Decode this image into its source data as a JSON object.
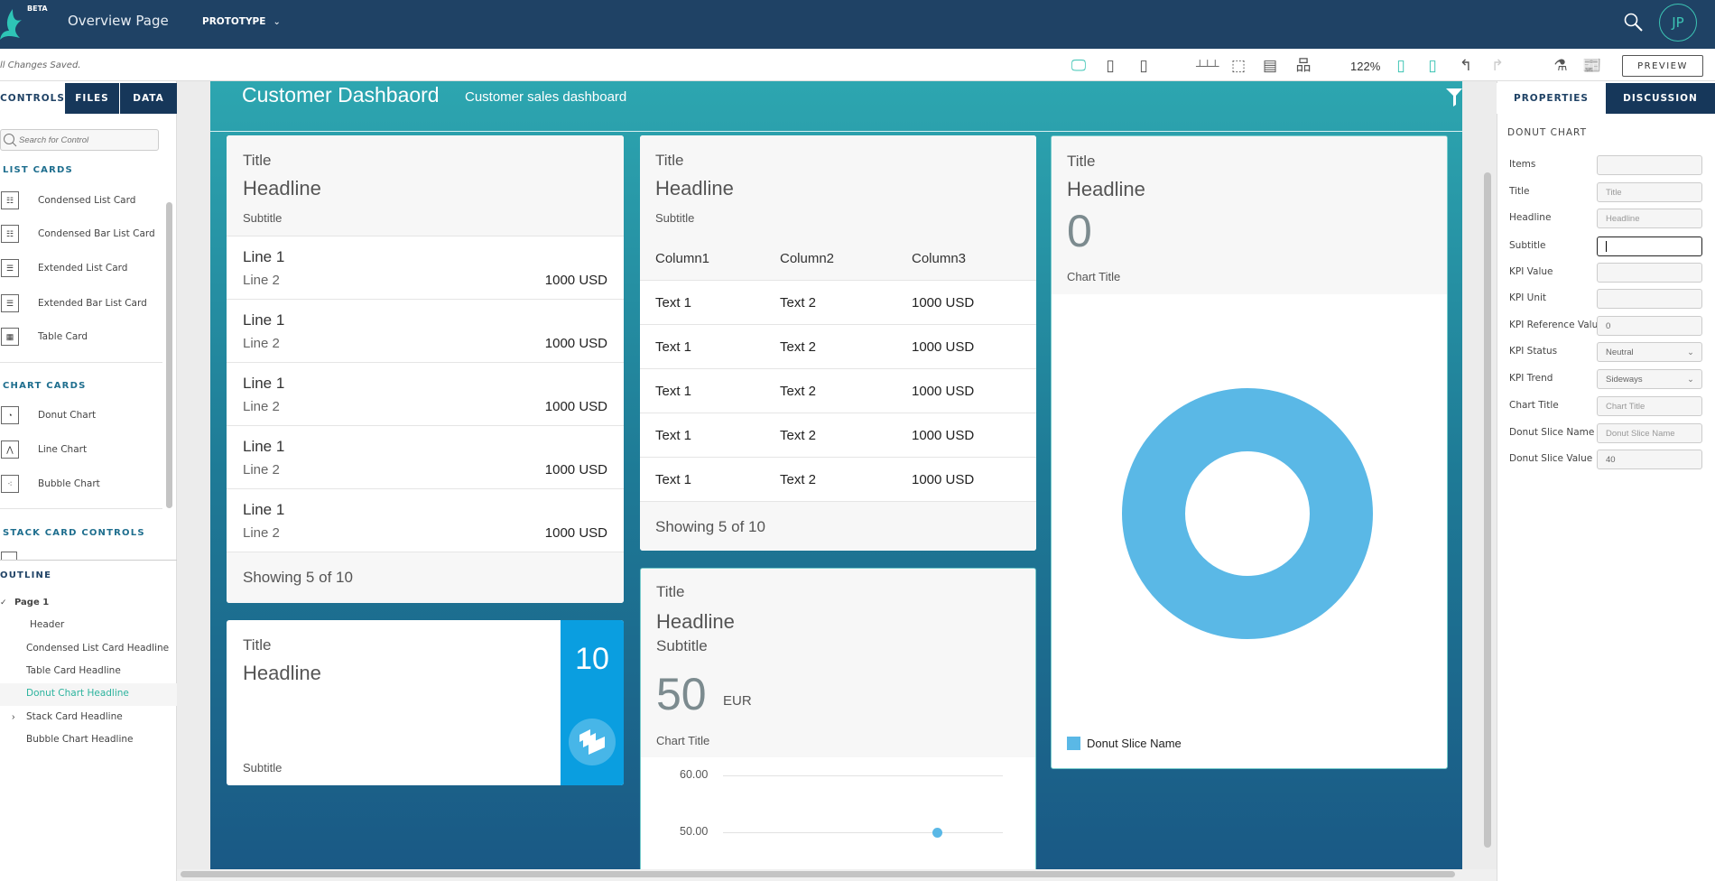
{
  "topbar": {
    "beta": "BETA",
    "app_title": "Overview Page",
    "mode": "PROTOTYPE",
    "mode_chevron": "chevron-down-icon",
    "avatar": "JP"
  },
  "toolbar": {
    "status": "ll Changes Saved.",
    "zoom": "122%",
    "preview": "PREVIEW",
    "accent": "#3cc4b4"
  },
  "left": {
    "tabs": [
      "CONTROLS",
      "FILES",
      "DATA"
    ],
    "search_placeholder": "Search for Control",
    "sections": [
      {
        "title": "LIST CARDS",
        "items": [
          "Condensed List Card",
          "Condensed Bar List Card",
          "Extended List Card",
          "Extended Bar List Card",
          "Table Card"
        ]
      },
      {
        "title": "CHART CARDS",
        "items": [
          "Donut Chart",
          "Line Chart",
          "Bubble Chart"
        ]
      },
      {
        "title": "STACK CARD CONTROLS",
        "items": []
      }
    ],
    "outline": {
      "title": "OUTLINE",
      "page": "Page 1",
      "items": [
        "Header",
        "Condensed List Card Headline",
        "Table Card Headline",
        "Donut Chart Headline",
        "Stack Card Headline",
        "Bubble Chart Headline"
      ],
      "selected": "Donut Chart Headline"
    }
  },
  "dashboard": {
    "title": "Customer Dashbaord",
    "subtitle": "Customer sales dashboard",
    "list_card": {
      "title": "Title",
      "headline": "Headline",
      "subtitle": "Subtitle",
      "rows": [
        {
          "l1": "Line 1",
          "l2": "Line 2",
          "value": "1000 USD"
        },
        {
          "l1": "Line 1",
          "l2": "Line 2",
          "value": "1000 USD"
        },
        {
          "l1": "Line 1",
          "l2": "Line 2",
          "value": "1000 USD"
        },
        {
          "l1": "Line 1",
          "l2": "Line 2",
          "value": "1000 USD"
        },
        {
          "l1": "Line 1",
          "l2": "Line 2",
          "value": "1000 USD"
        }
      ],
      "footer": "Showing 5 of 10"
    },
    "table_card": {
      "title": "Title",
      "headline": "Headline",
      "subtitle": "Subtitle",
      "columns": [
        "Column1",
        "Column2",
        "Column3"
      ],
      "rows": [
        [
          "Text 1",
          "Text 2",
          "1000 USD"
        ],
        [
          "Text 1",
          "Text 2",
          "1000 USD"
        ],
        [
          "Text 1",
          "Text 2",
          "1000 USD"
        ],
        [
          "Text 1",
          "Text 2",
          "1000 USD"
        ],
        [
          "Text 1",
          "Text 2",
          "1000 USD"
        ]
      ],
      "footer": "Showing 5 of 10"
    },
    "donut_card": {
      "title": "Title",
      "headline": "Headline",
      "kpi": "0",
      "chart_title": "Chart Title",
      "legend": "Donut Slice Name",
      "slice_value": 40,
      "color": "#5ab8e6"
    },
    "stack_card": {
      "title": "Title",
      "headline": "Headline",
      "subtitle": "Subtitle",
      "count": "10",
      "color": "#0a9ee0"
    },
    "line_card": {
      "title": "Title",
      "headline": "Headline",
      "subtitle": "Subtitle",
      "kpi": "50",
      "unit": "EUR",
      "chart_title": "Chart Title",
      "y_ticks": [
        "60.00",
        "50.00"
      ],
      "points": [
        50
      ]
    }
  },
  "right": {
    "tabs": [
      "PROPERTIES",
      "DISCUSSION"
    ],
    "section": "DONUT CHART",
    "fields": [
      {
        "label": "Items",
        "value": "",
        "placeholder": ""
      },
      {
        "label": "Title",
        "value": "",
        "placeholder": "Title"
      },
      {
        "label": "Headline",
        "value": "",
        "placeholder": "Headline"
      },
      {
        "label": "Subtitle",
        "value": "",
        "placeholder": "",
        "focused": true
      },
      {
        "label": "KPI Value",
        "value": "",
        "placeholder": ""
      },
      {
        "label": "KPI Unit",
        "value": "",
        "placeholder": ""
      },
      {
        "label": "KPI Reference Value",
        "value": "0",
        "placeholder": ""
      },
      {
        "label": "KPI Status",
        "value": "Neutral",
        "select": true
      },
      {
        "label": "KPI Trend",
        "value": "Sideways",
        "select": true
      },
      {
        "label": "Chart Title",
        "value": "",
        "placeholder": "Chart Title"
      },
      {
        "label": "Donut Slice Name",
        "value": "",
        "placeholder": "Donut Slice Name"
      },
      {
        "label": "Donut Slice Value",
        "value": "40",
        "placeholder": ""
      }
    ]
  }
}
